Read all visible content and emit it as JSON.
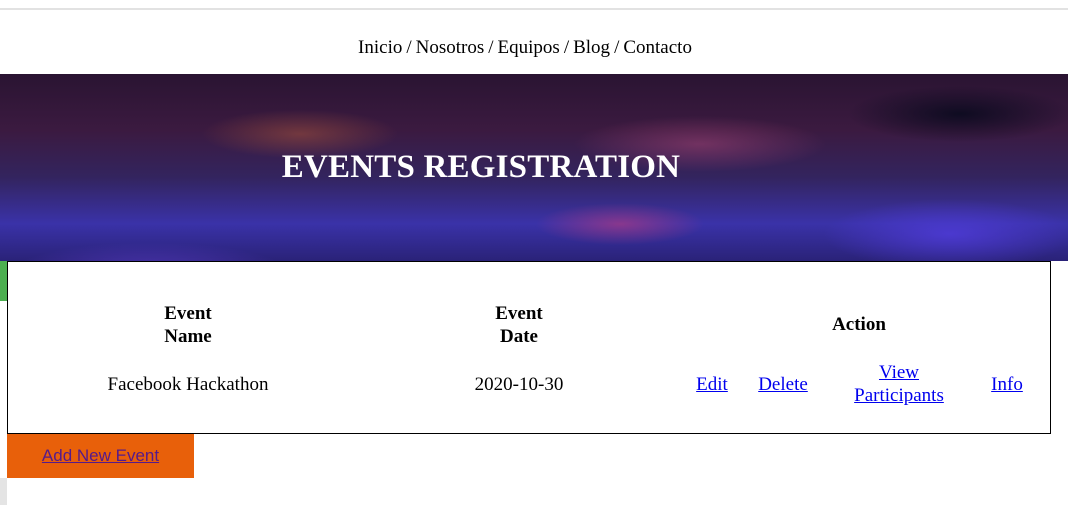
{
  "nav": {
    "items": [
      "Inicio",
      "Nosotros",
      "Equipos",
      "Blog",
      "Contacto"
    ],
    "separator": "/"
  },
  "hero": {
    "title": "EVENTS REGISTRATION"
  },
  "table": {
    "headers": {
      "event_name": [
        "Event",
        "Name"
      ],
      "event_date": [
        "Event",
        "Date"
      ],
      "action": "Action"
    },
    "rows": [
      {
        "name": "Facebook Hackathon",
        "date": "2020-10-30",
        "actions": {
          "edit": "Edit",
          "delete": "Delete",
          "view_participants": [
            "View",
            "Participants"
          ],
          "info": "Info"
        }
      }
    ]
  },
  "add_button": {
    "label": "Add New Event"
  },
  "colors": {
    "link": "#0000ee",
    "visited_link": "#551a8b",
    "add_button_bg": "#e8600a",
    "accent_green": "#4caf50"
  }
}
